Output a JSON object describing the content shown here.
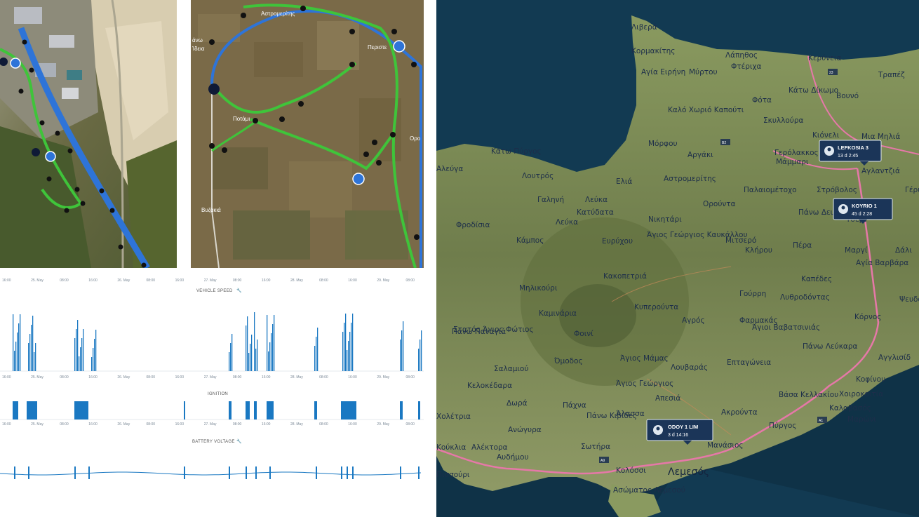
{
  "colors": {
    "route_green": "#3fc43a",
    "route_blue": "#2e74d8",
    "chart_blue": "#1a78c2",
    "sea": "#123a52",
    "land": "#7a8a54",
    "road_pink": "#e678a8",
    "badge_bg": "#1b3558"
  },
  "icons": {
    "start_marker": "circle-marker-icon",
    "key_marker": "key-icon",
    "direction_marker": "arrow-direction-icon",
    "wrench": "wrench-icon",
    "vehicle": "vehicle-icon"
  },
  "sat2": {
    "labels": [
      "Αστρομερίτης",
      "Περιστε",
      "Ποτάμι",
      "Βυζακιά",
      "Ορο",
      "άνω",
      "Ίδεια"
    ]
  },
  "timeline_ticks": [
    "16:00",
    "25. May",
    "08:00",
    "16:00",
    "26. May",
    "08:00",
    "16:00",
    "27. May",
    "08:00",
    "16:00",
    "28. May",
    "08:00",
    "16:00",
    "29. May",
    "08:00"
  ],
  "charts": {
    "speed_title": "VEHICLE SPEED",
    "ignition_title": "IGNITION",
    "battery_title": "BATTERY VOLTAGE"
  },
  "map": {
    "places": [
      {
        "name": "Λιβερά"
      },
      {
        "name": "Κορμακίτης"
      },
      {
        "name": "Λάπηθος"
      },
      {
        "name": "Κερύνεια"
      },
      {
        "name": "Τραπέζ"
      },
      {
        "name": "Φτέριχα"
      },
      {
        "name": "Αγία Ειρήνη"
      },
      {
        "name": "Μύρτου"
      },
      {
        "name": "Κάτω Δίκωμο"
      },
      {
        "name": "Βουνό"
      },
      {
        "name": "Φότα"
      },
      {
        "name": "Καλό Χωριό Καπούτι"
      },
      {
        "name": "Σκυλλούρα"
      },
      {
        "name": "Κιόνελι"
      },
      {
        "name": "Μια Μηλιά"
      },
      {
        "name": "Μόρφου"
      },
      {
        "name": "Αργάκι"
      },
      {
        "name": "Γερόλακκος"
      },
      {
        "name": "Μάμμαρι"
      },
      {
        "name": "Αγλαντζιά"
      },
      {
        "name": "Κάτω Πύργος"
      },
      {
        "name": "Αλεύγα"
      },
      {
        "name": "Λουτρός"
      },
      {
        "name": "Ελιά"
      },
      {
        "name": "Αστρομερίτης"
      },
      {
        "name": "Παλαιομέτοχο"
      },
      {
        "name": "Στρόβολος"
      },
      {
        "name": "Γέρι"
      },
      {
        "name": "Γαληνή"
      },
      {
        "name": "Λεύκα"
      },
      {
        "name": "Κατύδατα"
      },
      {
        "name": "Ορούντα"
      },
      {
        "name": "Πάνω Δευτερά"
      },
      {
        "name": "Τσέρι"
      },
      {
        "name": "Φροδίσια"
      },
      {
        "name": "Λεύκα"
      },
      {
        "name": "Νικητάρι"
      },
      {
        "name": "Κάμπος"
      },
      {
        "name": "Ευρύχου"
      },
      {
        "name": "Άγιος Γεώργιος Καυκάλλου"
      },
      {
        "name": "Μιτσερό"
      },
      {
        "name": "Κλήρου"
      },
      {
        "name": "Πέρα"
      },
      {
        "name": "Μαργί"
      },
      {
        "name": "Δάλι"
      },
      {
        "name": "Κακοπετριά"
      },
      {
        "name": "Αγία Βαρβάρα"
      },
      {
        "name": "Μηλικούρι"
      },
      {
        "name": "Καπέδες"
      },
      {
        "name": "Γούρρη"
      },
      {
        "name": "Λυθροδόντας"
      },
      {
        "name": "Ψευδά"
      },
      {
        "name": "Καμινάρια"
      },
      {
        "name": "Κυπερούντα"
      },
      {
        "name": "Αγρός"
      },
      {
        "name": "Φαρμακάς"
      },
      {
        "name": "Κόρνος"
      },
      {
        "name": "Πάνω Παναγιά"
      },
      {
        "name": "Φοινί"
      },
      {
        "name": "Στατός Άγιος Φώτιος"
      },
      {
        "name": "Άγιοι Βαβατσινιάς"
      },
      {
        "name": "Πάνω Λεύκαρα"
      },
      {
        "name": "Αγγλισίδ"
      },
      {
        "name": "Σαλαμιού"
      },
      {
        "name": "Όμοδος"
      },
      {
        "name": "Άγιος Μάμας"
      },
      {
        "name": "Λουβαράς"
      },
      {
        "name": "Επταγώνεια"
      },
      {
        "name": "Κελοκέδαρα"
      },
      {
        "name": "Άγιος Γεώργιος"
      },
      {
        "name": "Κοφίνου"
      },
      {
        "name": "Βάσα Κελλακίου"
      },
      {
        "name": "Χοιροκοιτία"
      },
      {
        "name": "Δωρά"
      },
      {
        "name": "Πάχνα"
      },
      {
        "name": "Απεσιά"
      },
      {
        "name": "Καλαβασός"
      },
      {
        "name": "Χολέτρια"
      },
      {
        "name": "Πάνω Κιβίδες"
      },
      {
        "name": "Άλασσα"
      },
      {
        "name": "Ακρούντα"
      },
      {
        "name": "Ανώγυρα"
      },
      {
        "name": "Μαρώνι"
      },
      {
        "name": "Πύργος"
      },
      {
        "name": "Κούκλια"
      },
      {
        "name": "Αλέκτορα"
      },
      {
        "name": "Σωτήρα"
      },
      {
        "name": "Αυδήμου"
      },
      {
        "name": "Ασώματος Λεμεσού"
      },
      {
        "name": "Κολόσσι"
      },
      {
        "name": "Πισσούρι"
      },
      {
        "name": "Μανάσιος"
      }
    ],
    "city_large": "Λεμεσός",
    "vehicles": [
      {
        "name": "LEFKOSIA 3",
        "time": "13 d 2:45"
      },
      {
        "name": "KOYRIO 1",
        "time": "45 d 2:28"
      },
      {
        "name": "ODOY 1 LIM",
        "time": "3 d 14:16"
      }
    ],
    "road_numbers": [
      "23",
      "B2",
      "A9",
      "A1"
    ]
  }
}
